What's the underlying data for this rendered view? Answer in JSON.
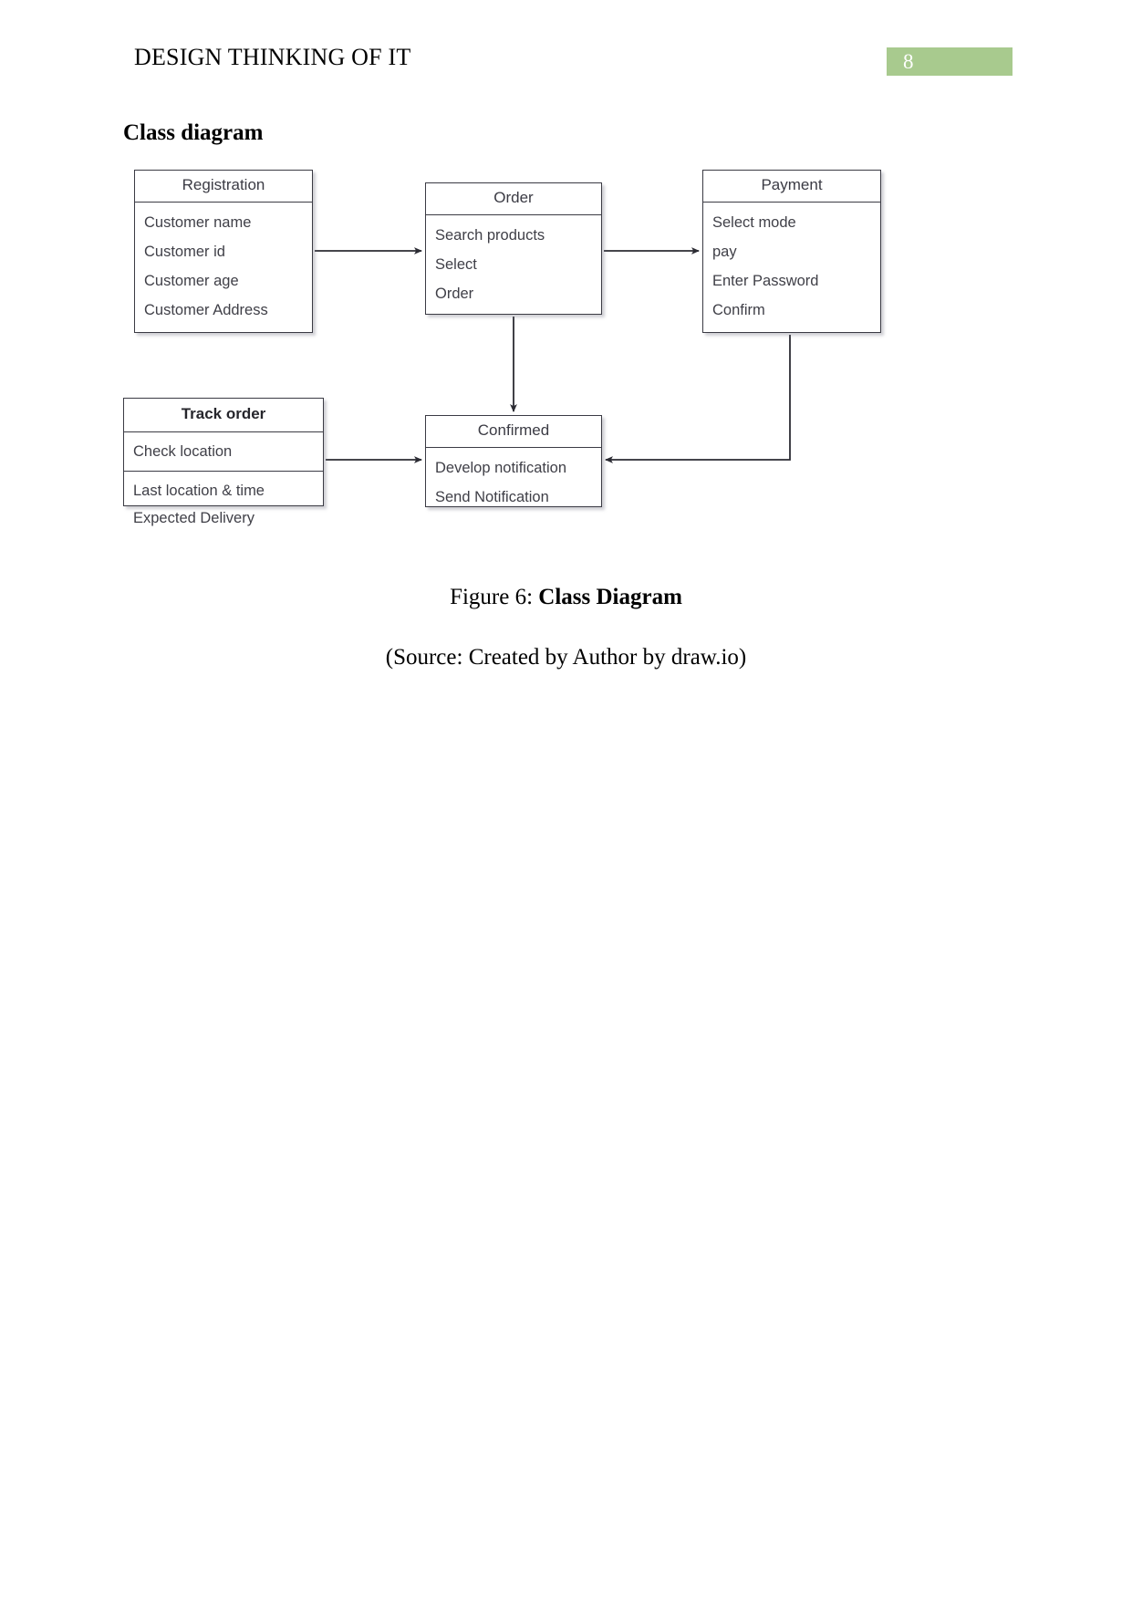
{
  "page": {
    "header_title": "DESIGN THINKING OF IT",
    "page_number": "8",
    "page_number_badge_color": "#a8ca8e",
    "section_heading": "Class diagram"
  },
  "diagram": {
    "type": "uml-class-diagram",
    "classes": [
      {
        "id": "registration",
        "name": "Registration",
        "name_bold": false,
        "compartments": [
          [
            "Customer name",
            "Customer id",
            "Customer age",
            "Customer Address"
          ]
        ]
      },
      {
        "id": "order",
        "name": "Order",
        "name_bold": false,
        "compartments": [
          [
            "Search products",
            "Select",
            "Order"
          ]
        ]
      },
      {
        "id": "payment",
        "name": "Payment",
        "name_bold": false,
        "compartments": [
          [
            "Select mode",
            "pay",
            "Enter Password",
            "Confirm"
          ]
        ]
      },
      {
        "id": "trackorder",
        "name": "Track order",
        "name_bold": true,
        "compartments": [
          [
            "Check location"
          ],
          [
            "Last location & time",
            "Expected Delivery"
          ]
        ]
      },
      {
        "id": "confirmed",
        "name": "Confirmed",
        "name_bold": false,
        "compartments": [
          [
            "Develop notification",
            "Send Notification"
          ]
        ]
      }
    ],
    "connections": [
      {
        "from": "registration",
        "to": "order",
        "direction": "right"
      },
      {
        "from": "order",
        "to": "payment",
        "direction": "right"
      },
      {
        "from": "order",
        "to": "confirmed",
        "direction": "down"
      },
      {
        "from": "trackorder",
        "to": "confirmed",
        "direction": "right"
      },
      {
        "from": "payment",
        "to": "confirmed",
        "direction": "down-left"
      }
    ],
    "line_color": "#2b2b33"
  },
  "caption": {
    "label": "Figure 6: ",
    "title": "Class Diagram",
    "source": "(Source: Created by Author by draw.io)"
  }
}
